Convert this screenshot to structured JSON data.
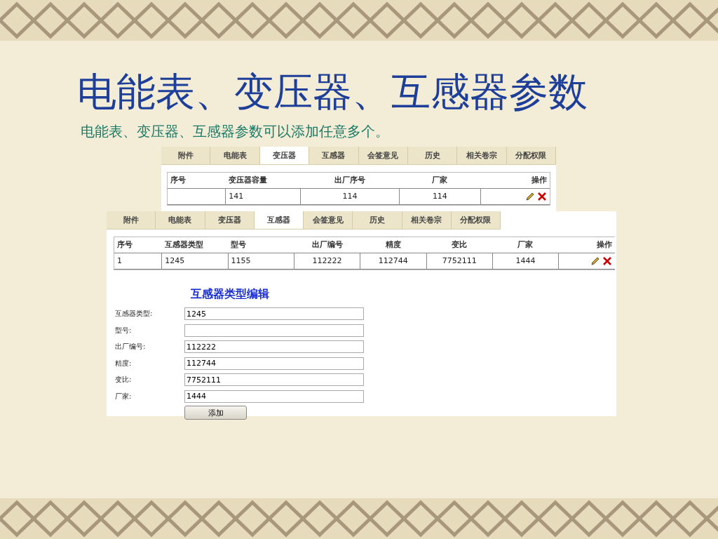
{
  "slide": {
    "title": "电能表、变压器、互感器参数",
    "subtitle": "电能表、变压器、互感器参数可以添加任意多个。"
  },
  "panels": [
    {
      "tabs": [
        {
          "label": "附件",
          "selected": false
        },
        {
          "label": "电能表",
          "selected": false
        },
        {
          "label": "变压器",
          "selected": true
        },
        {
          "label": "互感器",
          "selected": false
        },
        {
          "label": "会签意见",
          "selected": false
        },
        {
          "label": "历史",
          "selected": false
        },
        {
          "label": "相关卷宗",
          "selected": false
        },
        {
          "label": "分配权限",
          "selected": false
        }
      ],
      "table": {
        "columns": [
          "序号",
          "变压器容量",
          "出厂序号",
          "厂家",
          "操作"
        ],
        "rows": [
          {
            "values": [
              "141",
              "114",
              "114"
            ]
          }
        ]
      }
    },
    {
      "tabs": [
        {
          "label": "附件",
          "selected": false
        },
        {
          "label": "电能表",
          "selected": false
        },
        {
          "label": "变压器",
          "selected": false
        },
        {
          "label": "互感器",
          "selected": true
        },
        {
          "label": "会签意见",
          "selected": false
        },
        {
          "label": "历史",
          "selected": false
        },
        {
          "label": "相关卷宗",
          "selected": false
        },
        {
          "label": "分配权限",
          "selected": false
        }
      ],
      "table": {
        "columns": [
          "序号",
          "互感器类型",
          "型号",
          "出厂编号",
          "精度",
          "变比",
          "厂家",
          "操作"
        ],
        "rows": [
          {
            "number": "1",
            "values": [
              "1245",
              "1155",
              "112222",
              "112744",
              "7752111",
              "1444"
            ]
          }
        ]
      },
      "form": {
        "title": "互感器类型编辑",
        "fields": [
          {
            "label": "互感器类型:",
            "value": "1245"
          },
          {
            "label": "型号:"
          },
          {
            "label": "出厂编号:",
            "value": "112222"
          },
          {
            "label": "精度:",
            "value": "112744"
          },
          {
            "label": "变比:",
            "value": "7752111"
          },
          {
            "label": "厂家:",
            "value": "1444"
          }
        ],
        "button": "添加"
      }
    }
  ]
}
